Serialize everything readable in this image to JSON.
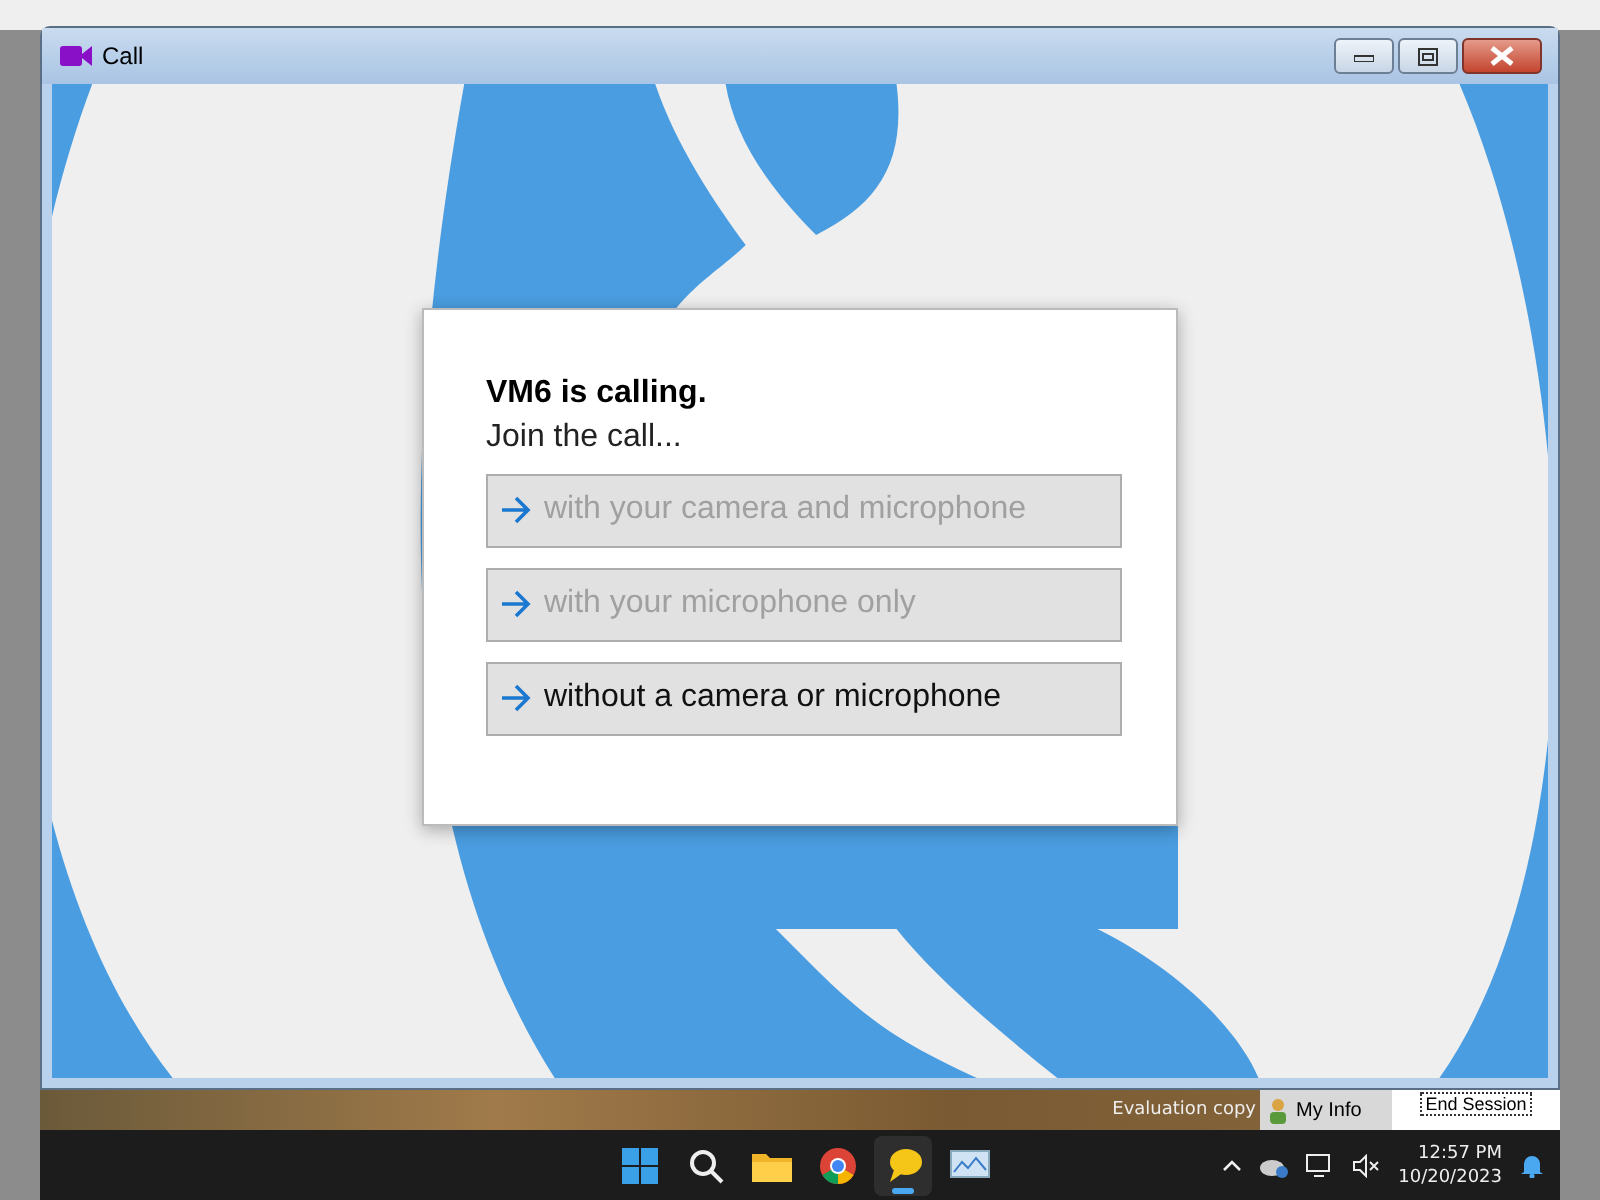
{
  "window": {
    "title": "Call"
  },
  "dialog": {
    "heading": "VM6 is calling.",
    "prompt": "Join the call...",
    "options": [
      {
        "label": "with your camera and microphone",
        "disabled": true
      },
      {
        "label": "with your microphone only",
        "disabled": true
      },
      {
        "label": "without a camera or microphone",
        "disabled": false
      }
    ]
  },
  "session_bar": {
    "notice": "Evaluation copy",
    "my_info": "My Info",
    "end_session": "End Session"
  },
  "taskbar": {
    "apps": [
      {
        "kind": "start",
        "active": false
      },
      {
        "kind": "search",
        "active": false
      },
      {
        "kind": "files",
        "active": false
      },
      {
        "kind": "browser",
        "active": false
      },
      {
        "kind": "chat",
        "active": true
      },
      {
        "kind": "monitor",
        "active": false
      }
    ],
    "time": "12:57 PM",
    "date": "10/20/2023"
  }
}
